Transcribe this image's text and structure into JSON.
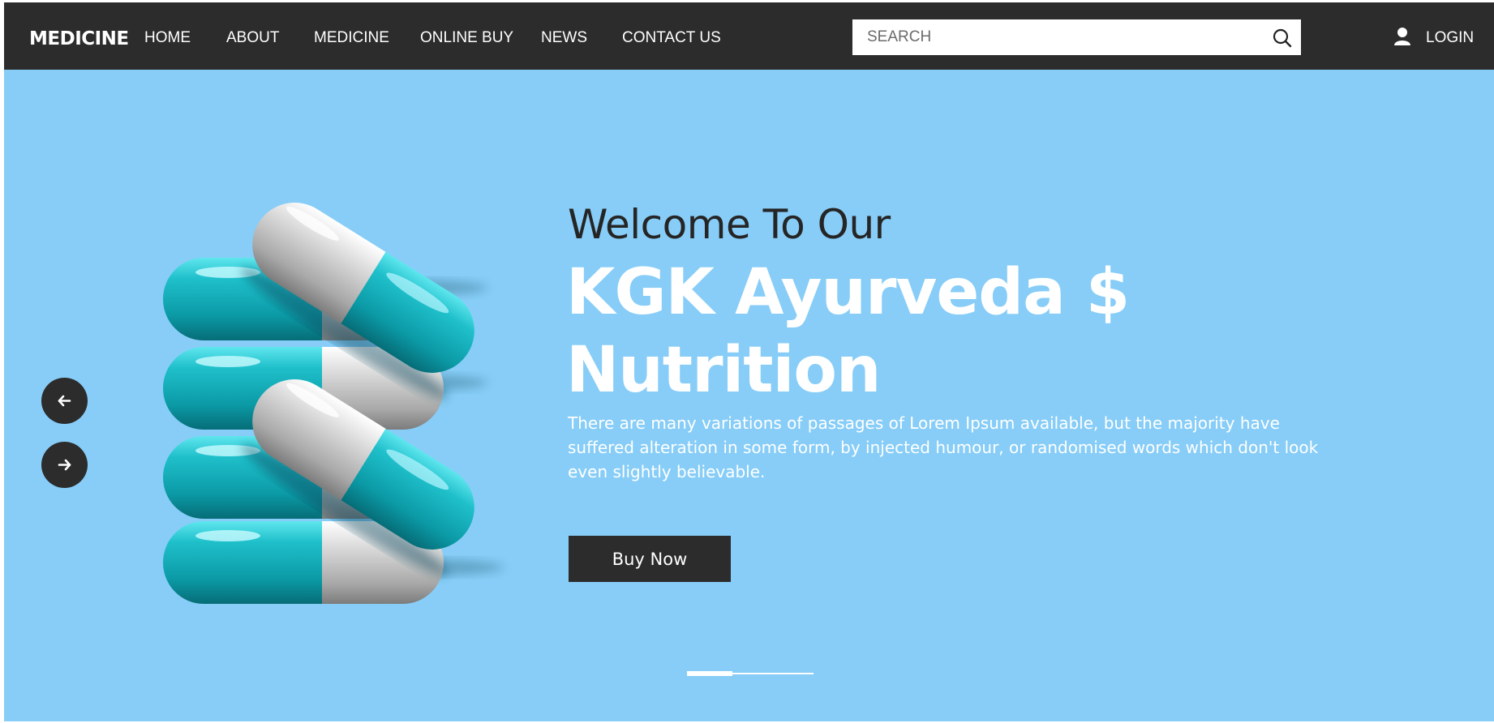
{
  "header": {
    "logo": "MEDICINE",
    "nav": [
      {
        "label": "HOME"
      },
      {
        "label": "ABOUT"
      },
      {
        "label": "MEDICINE"
      },
      {
        "label": "ONLINE BUY"
      },
      {
        "label": "NEWS"
      },
      {
        "label": "CONTACT US"
      }
    ],
    "search": {
      "placeholder": "SEARCH",
      "value": ""
    },
    "login_label": "LOGIN"
  },
  "hero": {
    "welcome": "Welcome To Our",
    "headline_line1": "KGK Ayurveda $",
    "headline_line2": "Nutrition",
    "description": "There are many variations of passages of Lorem Ipsum available, but the majority have suffered alteration in some form, by injected humour, or randomised words which don't look even slightly believable.",
    "button_label": "Buy Now",
    "slides_total": 3,
    "active_slide": 1
  },
  "colors": {
    "header_bg": "#2c2c2c",
    "hero_bg": "#87cdf7",
    "capsule_teal": "#16a8b3",
    "capsule_gray": "#c4c4c4",
    "headline": "#ffffff",
    "welcome_text": "#252525"
  },
  "icons": {
    "search": "search-icon",
    "login": "user-icon",
    "prev": "arrow-left-icon",
    "next": "arrow-right-icon"
  }
}
